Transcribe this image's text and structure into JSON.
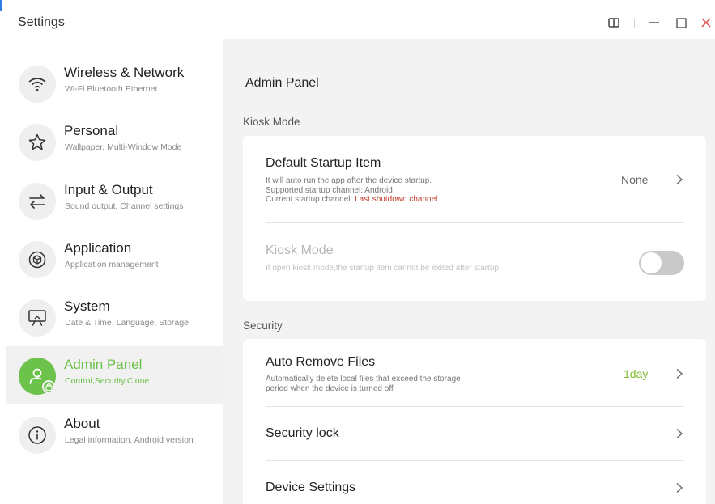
{
  "window": {
    "title": "Settings"
  },
  "colors": {
    "accent_green": "#6cc24a",
    "warning_red": "#c0392b",
    "close_red": "#e04b4b",
    "value_green": "#7fbb2f"
  },
  "sidebar": {
    "items": [
      {
        "label": "Wireless & Network",
        "sub": "Wi-Fi Bluetooth Ethernet",
        "icon": "wifi-icon"
      },
      {
        "label": "Personal",
        "sub": "Wallpaper, Multi-Window Mode",
        "icon": "star-icon"
      },
      {
        "label": "Input & Output",
        "sub": "Sound output, Channel settings",
        "icon": "swap-arrows-icon"
      },
      {
        "label": "Application",
        "sub": "Application management",
        "icon": "cube-icon"
      },
      {
        "label": "System",
        "sub": "Date & Time, Language, Storage",
        "icon": "monitor-icon"
      },
      {
        "label": "Admin Panel",
        "sub": "Control,Security,Clone",
        "icon": "admin-user-lock-icon",
        "active": true
      },
      {
        "label": "About",
        "sub": "Legal information, Android version",
        "icon": "info-icon"
      }
    ]
  },
  "main": {
    "title": "Admin Panel",
    "kiosk_section": {
      "title": "Kiosk Mode",
      "default_startup": {
        "title": "Default Startup Item",
        "desc_line1": "It will auto run the app after the device startup.",
        "desc_line2": "Supported startup channel: Android",
        "desc_line3_prefix": "Current startup channel: ",
        "desc_line3_value": "Last shutdown channel",
        "value": "None"
      },
      "kiosk_mode": {
        "title": "Kiosk Mode",
        "desc": "If open kiosk mode,the startup item cannot be exited after startup.",
        "enabled": false
      }
    },
    "security_section": {
      "title": "Security",
      "auto_remove": {
        "title": "Auto Remove Files",
        "desc_line1": "Automatically delete local files that exceed the storage",
        "desc_line2": "period when the device is turned off",
        "value": "1day"
      },
      "security_lock": {
        "title": "Security lock"
      },
      "device_settings": {
        "title": "Device Settings"
      }
    }
  }
}
